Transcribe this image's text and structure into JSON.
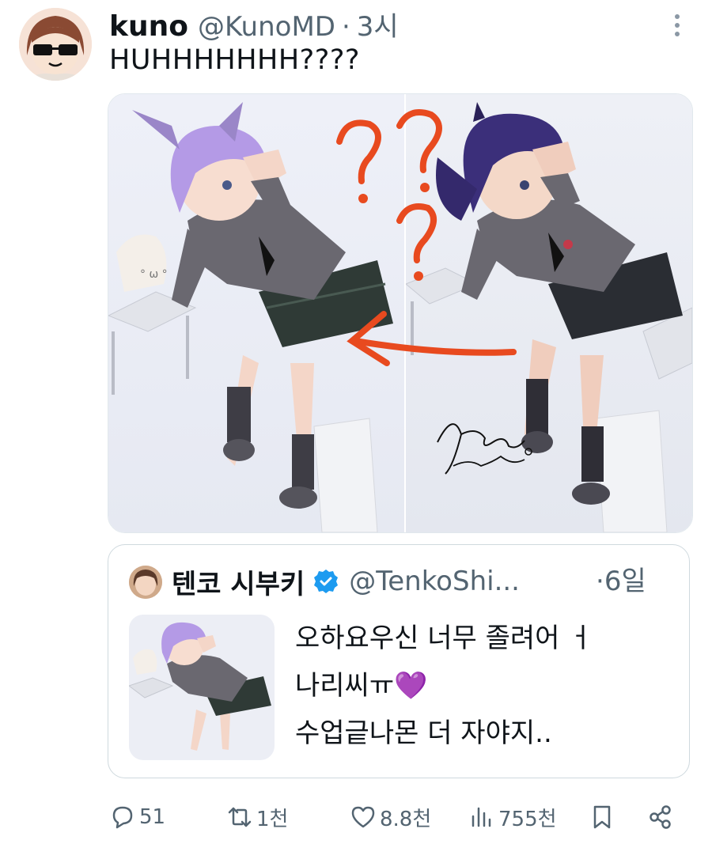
{
  "tweet": {
    "display_name": "kuno",
    "handle": "@KunoMD",
    "separator": "·",
    "time": "3시",
    "text": "HUHHHHHHH????",
    "avatar_icon": "sunglasses-avatar-icon",
    "more_icon": "more-vertical-icon"
  },
  "media": {
    "annotation_marks": [
      "?",
      "?",
      "?"
    ],
    "signature_text": "Hanabi Kyramie"
  },
  "quote": {
    "display_name": "텐코 시부키",
    "handle": "@TenkoShi...",
    "separator": "·",
    "time": "6일",
    "text_lines": [
      "오하요우신 너무 졸려어 ㅓ",
      "나리씨ㅠ",
      "수업긑나몬 더 자야지.."
    ],
    "heart_emoji": "💜",
    "verified_icon": "verified-badge-icon",
    "verified_color": "#1d9bf0"
  },
  "actions": {
    "replies": "51",
    "retweets": "1천",
    "likes": "8.8천",
    "views": "755천"
  },
  "colors": {
    "text": "#0f1419",
    "secondary": "#536471",
    "annotation_red": "#e84a1f",
    "hair_left": "#b49ae6",
    "hair_right": "#3b2f7a",
    "sweater": "#6a6870"
  }
}
